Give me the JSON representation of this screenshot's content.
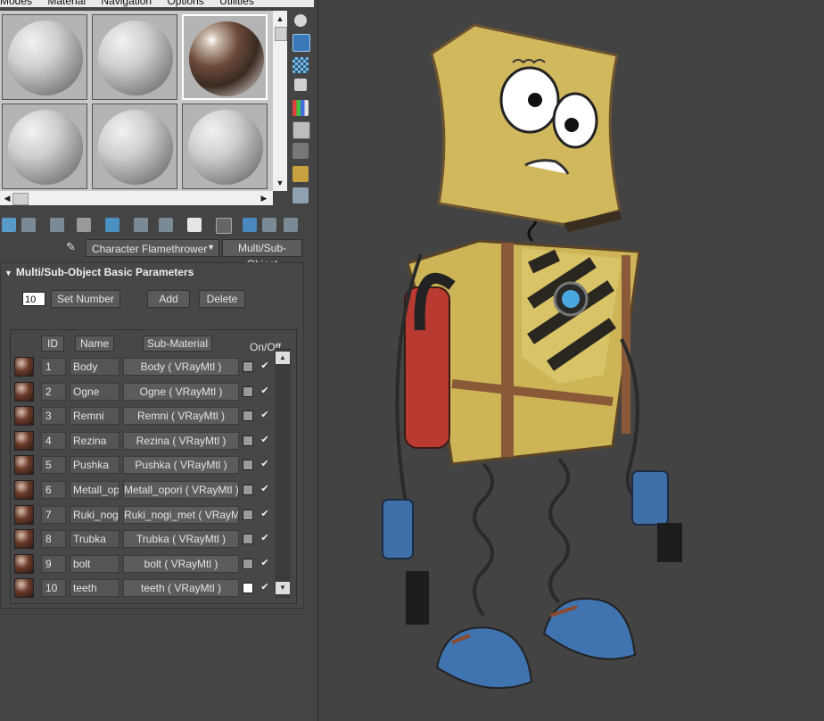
{
  "menu": [
    "Modes",
    "Material",
    "Navigation",
    "Options",
    "Utilities"
  ],
  "material_name": "Character Flamethrower",
  "material_type": "Multi/Sub-Object",
  "rollout_title": "Multi/Sub-Object Basic Parameters",
  "count": "10",
  "buttons": {
    "set_number": "Set Number",
    "add": "Add",
    "delete": "Delete"
  },
  "columns": {
    "id": "ID",
    "name": "Name",
    "submaterial": "Sub-Material",
    "onoff": "On/Off"
  },
  "rows": [
    {
      "id": "1",
      "name": "Body",
      "material": "Body  ( VRayMtl )",
      "swatch": "#9a9a9a",
      "on": true
    },
    {
      "id": "2",
      "name": "Ogne",
      "material": "Ogne  ( VRayMtl )",
      "swatch": "#9a9a9a",
      "on": true
    },
    {
      "id": "3",
      "name": "Remni",
      "material": "Remni  ( VRayMtl )",
      "swatch": "#9a9a9a",
      "on": true
    },
    {
      "id": "4",
      "name": "Rezina",
      "material": "Rezina  ( VRayMtl )",
      "swatch": "#9a9a9a",
      "on": true
    },
    {
      "id": "5",
      "name": "Pushka",
      "material": "Pushka  ( VRayMtl )",
      "swatch": "#9a9a9a",
      "on": true
    },
    {
      "id": "6",
      "name": "Metall_opc",
      "material": "Metall_opori  ( VRayMtl )",
      "swatch": "#9a9a9a",
      "on": true
    },
    {
      "id": "7",
      "name": "Ruki_nogi_",
      "material": "Ruki_nogi_met  ( VRayMtl )",
      "swatch": "#9a9a9a",
      "on": true
    },
    {
      "id": "8",
      "name": "Trubka",
      "material": "Trubka  ( VRayMtl )",
      "swatch": "#9a9a9a",
      "on": true
    },
    {
      "id": "9",
      "name": "bolt",
      "material": "bolt  ( VRayMtl )",
      "swatch": "#9a9a9a",
      "on": true
    },
    {
      "id": "10",
      "name": "teeth",
      "material": "teeth  ( VRayMtl )",
      "swatch": "#ffffff",
      "on": true
    }
  ],
  "toolbar_icons": [
    "get-material-icon",
    "put-to-scene-icon",
    "assign-material-icon",
    "delete-icon",
    "make-unique-icon",
    "put-to-library-icon",
    "save-icon",
    "material-id-icon",
    "show-map-icon",
    "show-background-icon",
    "go-to-parent-icon",
    "go-forward-icon",
    "pick-material-icon"
  ],
  "side_tools": [
    "sample-type-icon",
    "backlight-icon",
    "background-icon",
    "uv-tiling-icon",
    "video-color-icon",
    "make-preview-icon",
    "options-icon",
    "select-by-material-icon",
    "material-navigator-icon"
  ],
  "accent": "#4a9fd8"
}
